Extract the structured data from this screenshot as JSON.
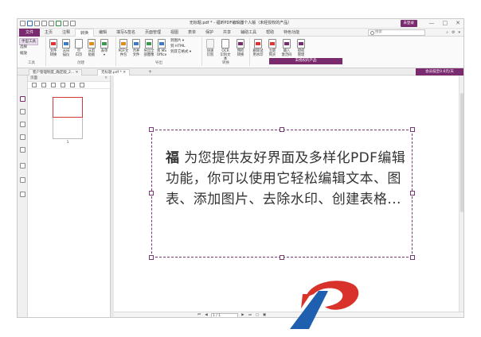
{
  "titlebar": {
    "title": "无标题.pdf * - 福昕PDF编辑器个人版（未经授权的产品）",
    "login_label": "未登录",
    "window_controls": [
      "—",
      "□",
      "✕"
    ]
  },
  "menu": {
    "items": [
      "文件",
      "主页",
      "注释",
      "转换",
      "编辑",
      "填写&签名",
      "页面管理",
      "视图",
      "表单",
      "保护",
      "共享",
      "辅助工具",
      "帮助",
      "特色功能"
    ],
    "active": "转换",
    "search_placeholder": "搜索",
    "right_icons": [
      "search-icon",
      "settings-icon",
      "dropdown-icon"
    ]
  },
  "ribbon": {
    "tools": {
      "hand": "手型工具",
      "select": "选择",
      "zoom": "缩放",
      "label": "工具"
    },
    "create": {
      "buttons": [
        "文件\n转换",
        "从扫\n描仪",
        "空\n白页",
        "从剪\n贴板",
        "表单\n▾"
      ],
      "label": "创建"
    },
    "convert": {
      "buttons": [
        "PDF文\n件包",
        "合并\n文件",
        "导出全\n部图像",
        "到 MS\nOffice"
      ],
      "small": [
        "到图片 ▾",
        "到 HTML",
        "到其它格式 ▾"
      ],
      "label": "导出"
    },
    "ocr": {
      "buttons": [
        "快速\n识别",
        "OCR\n识别文本",
        "预检\n转换"
      ],
      "label": "转换"
    },
    "product": {
      "buttons": [
        "删除试\n用水印",
        "立即\n购买",
        "输入\n激活码",
        "授权\n管理"
      ],
      "label": "未授权的产品"
    }
  },
  "tabs": {
    "items": [
      "客户管理制度_确定版_2... ✕",
      "无标题.pdf * ✕"
    ],
    "active": "无标题.pdf * ✕",
    "add": "+",
    "promo": "会员低至0.6元/天"
  },
  "panel": {
    "title": "页面",
    "close": "✕",
    "thumb_number": "1"
  },
  "document": {
    "bold_lead": "福",
    "text": " 为您提供友好界面及多样化PDF编辑功能，你可以使用它轻松编辑文本、图表、添加图片、去除水印、创建表格..."
  },
  "status": {
    "page_value": "1 / 1",
    "nav_first": "⏮",
    "nav_prev": "◀",
    "nav_next": "▶",
    "nav_last": "⏭"
  },
  "colors": {
    "brand": "#7a2a6e",
    "selection": "#d23a3a",
    "logo_red": "#d8322a",
    "logo_blue": "#1f5fb0"
  }
}
